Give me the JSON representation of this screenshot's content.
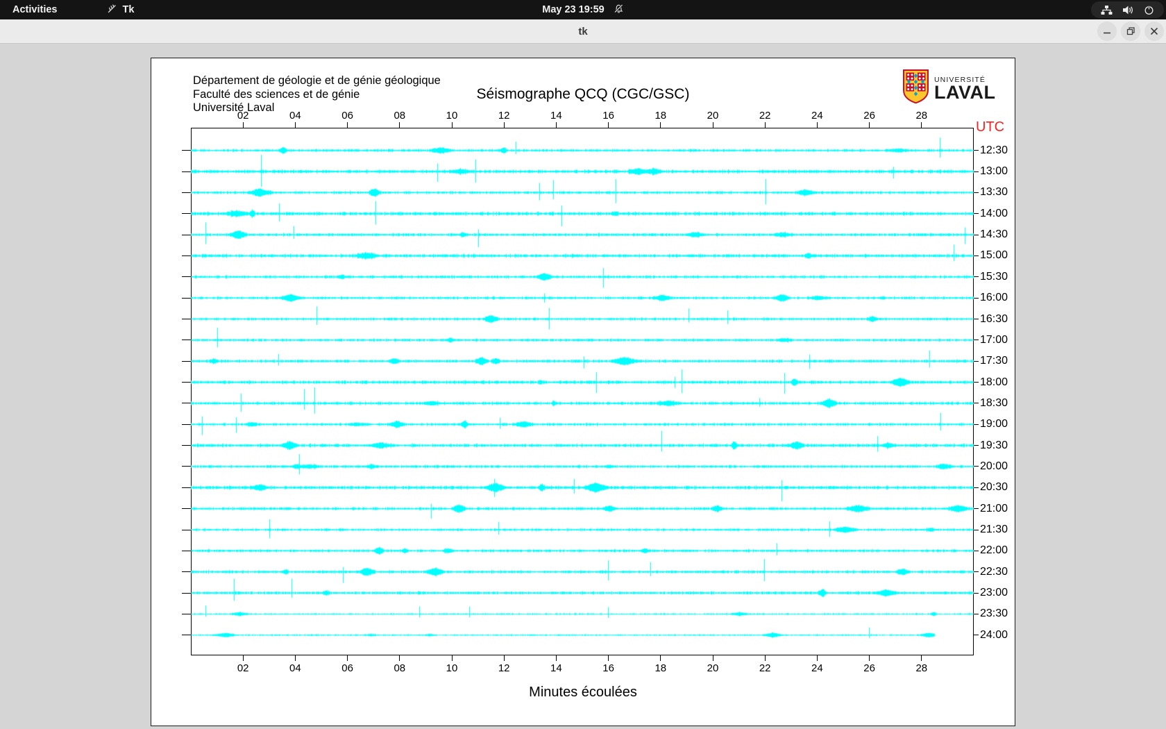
{
  "top_bar": {
    "activities_label": "Activities",
    "app_name": "Tk",
    "clock": "May 23 19:59",
    "icons": [
      "tk-icon",
      "notifications-disabled-icon",
      "network-icon",
      "volume-icon",
      "power-icon"
    ]
  },
  "window": {
    "title": "tk",
    "controls": [
      "minimize",
      "maximize",
      "close"
    ]
  },
  "header": {
    "line1": "Département de géologie et de génie géologique",
    "line2": "Faculté des sciences et de génie",
    "line3": "Université Laval",
    "title": "Séismographe QCQ (CGC/GSC)"
  },
  "logo": {
    "line1": "UNIVERSITÉ",
    "line2": "LAVAL",
    "colors": {
      "red": "#c8102e",
      "gold": "#ffc72c",
      "blue": "#00a0e0"
    }
  },
  "chart": {
    "type": "seismogram-helicorder",
    "utc_label": "UTC",
    "utc_color": "#ff1f1f",
    "xlabel": "Minutes écoulées",
    "x_ticks": [
      "02",
      "04",
      "06",
      "08",
      "10",
      "12",
      "14",
      "16",
      "18",
      "20",
      "22",
      "24",
      "26",
      "28"
    ],
    "minutes_span": 30,
    "row_labels": [
      "12:30",
      "13:00",
      "13:30",
      "14:00",
      "14:30",
      "15:00",
      "15:30",
      "16:00",
      "16:30",
      "17:00",
      "17:30",
      "18:00",
      "18:30",
      "19:00",
      "19:30",
      "20:00",
      "20:30",
      "21:00",
      "21:30",
      "22:00",
      "22:30",
      "23:00",
      "23:30",
      "24:00"
    ],
    "trace_color": "#00ffff",
    "last_trace_end_minutes": 28.5,
    "seed": 1234
  }
}
